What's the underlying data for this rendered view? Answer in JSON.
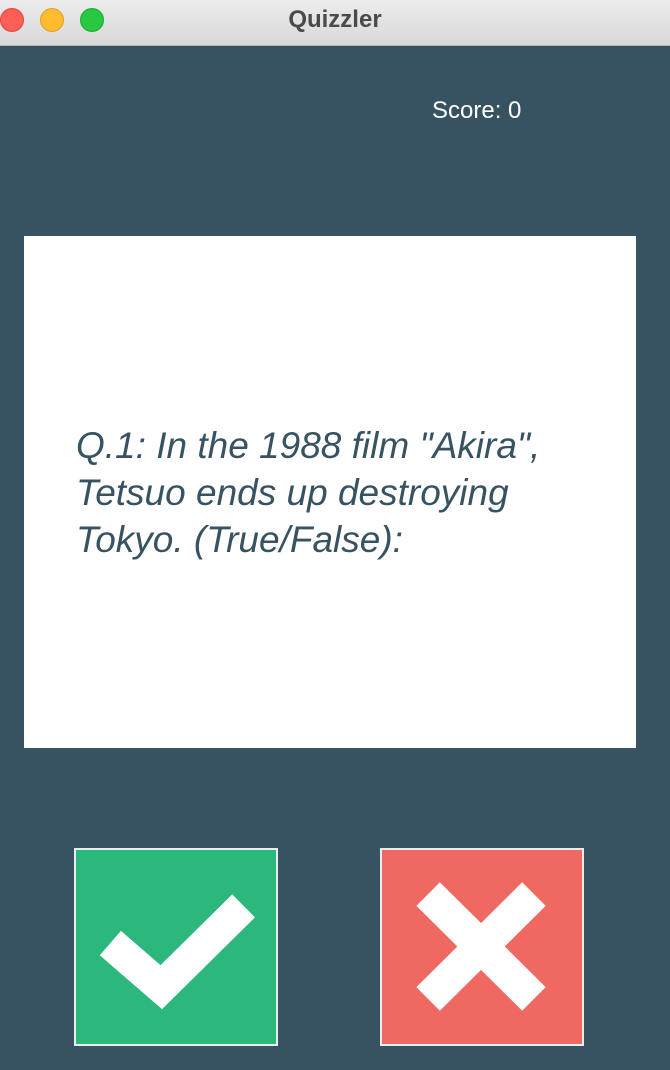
{
  "window": {
    "title": "Quizzler"
  },
  "score": {
    "text": "Score: 0"
  },
  "question": {
    "text": "Q.1: In the 1988 film \"Akira\", Tetsuo ends up destroying Tokyo. (True/False):"
  },
  "buttons": {
    "true_icon": "checkmark-icon",
    "false_icon": "cross-icon"
  },
  "colors": {
    "theme_background": "#375362",
    "card_background": "#ffffff",
    "question_text": "#375362",
    "true_button": "#2cb87c",
    "false_button": "#ef6861"
  }
}
